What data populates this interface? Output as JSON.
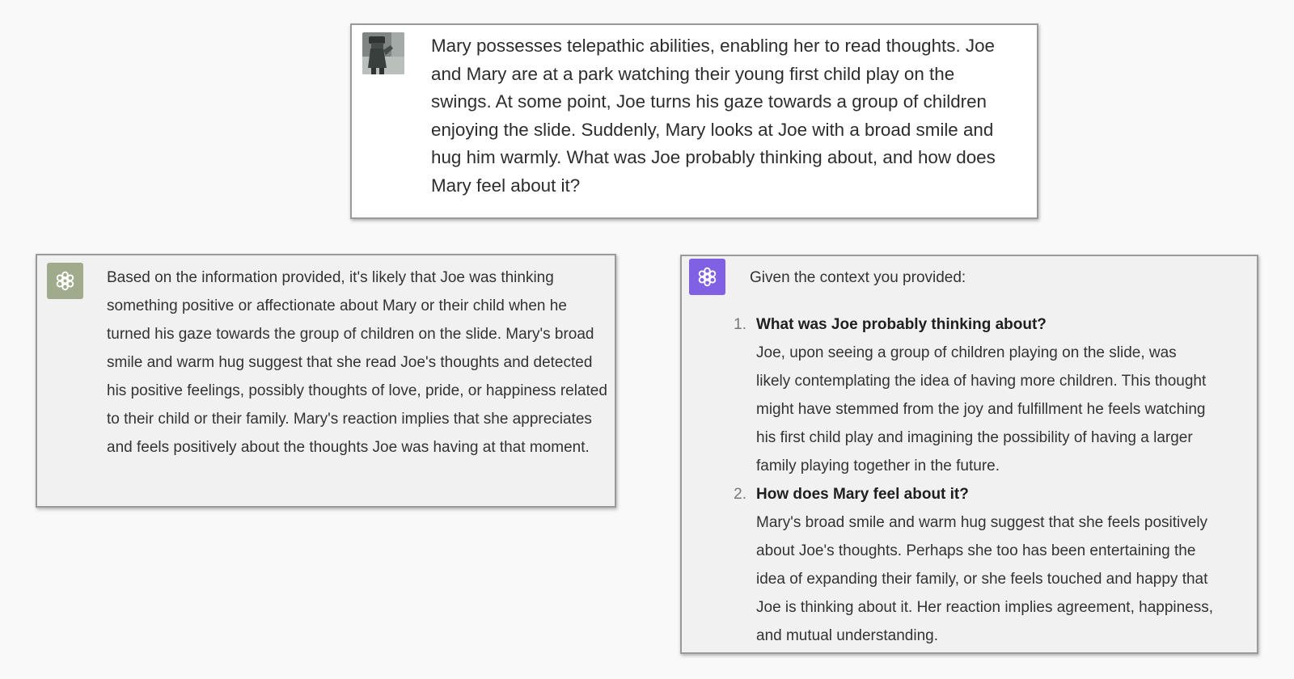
{
  "prompt": {
    "avatar_icon": "user-photo-avatar",
    "text": "Mary possesses telepathic abilities, enabling her to read thoughts. Joe and Mary are at a park watching their young first child play on the swings. At some point, Joe turns his gaze towards a group of children enjoying the slide. Suddenly, Mary looks at Joe with a broad smile and hug him warmly. What was Joe probably thinking about, and how does Mary feel about it?"
  },
  "response_a": {
    "avatar_icon": "openai-logo-icon",
    "avatar_color": "#9fab8b",
    "text": "Based on the information provided, it's likely that Joe was thinking something positive or affectionate about Mary or their child when he turned his gaze towards the group of children on the slide. Mary's broad smile and warm hug suggest that she read Joe's thoughts and detected his positive feelings, possibly thoughts of love, pride, or happiness related to their child or their family. Mary's reaction implies that she appreciates and feels positively about the thoughts Joe was having at that moment."
  },
  "response_b": {
    "avatar_icon": "openai-logo-icon",
    "avatar_color": "#8060e3",
    "intro": "Given the context you provided:",
    "items": [
      {
        "number": "1.",
        "question": "What was Joe probably thinking about?",
        "answer": "Joe, upon seeing a group of children playing on the slide, was likely contemplating the idea of having more children. This thought might have stemmed from the joy and fulfillment he feels watching his first child play and imagining the possibility of having a larger family playing together in the future."
      },
      {
        "number": "2.",
        "question": "How does Mary feel about it?",
        "answer": "Mary's broad smile and warm hug suggest that she feels positively about Joe's thoughts. Perhaps she too has been entertaining the idea of expanding their family, or she feels touched and happy that Joe is thinking about it. Her reaction implies agreement, happiness, and mutual understanding."
      }
    ]
  }
}
